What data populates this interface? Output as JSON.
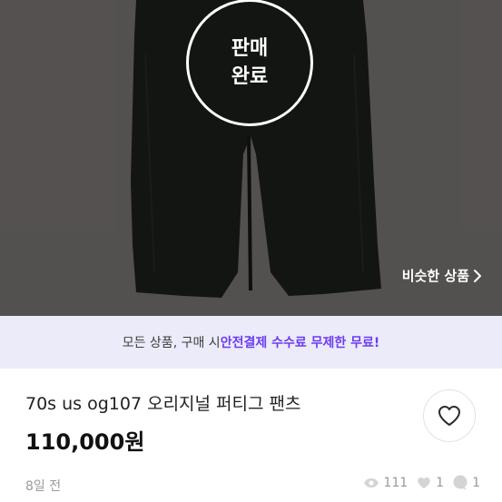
{
  "product_image": {
    "sold_badge": {
      "line1": "판매",
      "line2": "완료"
    },
    "similar_link": "비슷한 상품"
  },
  "notice": {
    "prefix": "모든 상품, 구매 시 ",
    "highlight": "안전결제 수수료 무제한 무료!"
  },
  "product": {
    "title": "70s us og107 오리지널 퍼티그 팬츠",
    "price": "110,000원",
    "posted": "8일 전",
    "views": "111",
    "likes": "1",
    "chats": "1"
  },
  "icons": [
    "chevron-right-icon",
    "heart-icon",
    "eye-icon",
    "chat-icon"
  ],
  "colors": {
    "accent": "#6c3cf2",
    "notice_bg": "#ecebfa"
  }
}
